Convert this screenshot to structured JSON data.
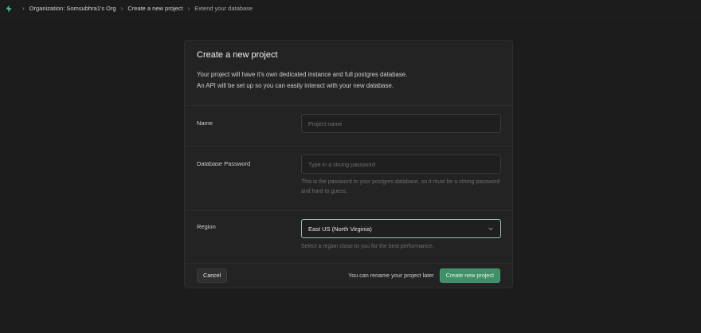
{
  "breadcrumb": {
    "items": [
      "Organization: Somsubhra1's Org",
      "Create a new project",
      "Extend your database"
    ]
  },
  "card": {
    "title": "Create a new project",
    "description_line1": "Your project will have it's own dedicated instance and full postgres database.",
    "description_line2": "An API will be set up so you can easily interact with your new database."
  },
  "name_field": {
    "label": "Name",
    "placeholder": "Project name"
  },
  "password_field": {
    "label": "Database Password",
    "placeholder": "Type in a strong password",
    "help": "This is the password to your postgres database, so it must be a strong password and hard to guess."
  },
  "region_field": {
    "label": "Region",
    "selected": "East US (North Virginia)",
    "help": "Select a region close to you for the best performance."
  },
  "footer": {
    "cancel_label": "Cancel",
    "rename_note": "You can rename your project later",
    "create_label": "Create new project"
  },
  "colors": {
    "background": "#1c1c1c",
    "card": "#232323",
    "accent": "#3f8f68",
    "focus_border": "#9fbfae"
  }
}
